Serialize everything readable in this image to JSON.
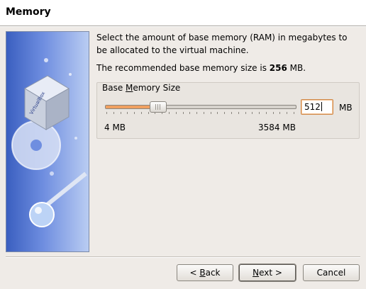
{
  "header": {
    "title": "Memory"
  },
  "description": "Select the amount of base memory (RAM) in megabytes to be allocated to the virtual machine.",
  "recommend": {
    "prefix": "The recommended base memory size is ",
    "value": "256",
    "suffix": " MB."
  },
  "group": {
    "label_before": "Base ",
    "label_mnemonic": "M",
    "label_after": "emory Size"
  },
  "slider": {
    "min_label": "4 MB",
    "max_label": "3584 MB",
    "value": 512,
    "min": 4,
    "max": 3584
  },
  "memory_input": {
    "value": "512",
    "unit": "MB"
  },
  "banner": {
    "logo_text": "VirtualBox"
  },
  "buttons": {
    "back": {
      "prefix": "< ",
      "mnemonic": "B",
      "rest": "ack"
    },
    "next": {
      "mnemonic": "N",
      "rest": "ext >"
    },
    "cancel": {
      "label": "Cancel"
    }
  },
  "colors": {
    "accent": "#f0a060",
    "banner_blue": "#3a5fc0"
  }
}
